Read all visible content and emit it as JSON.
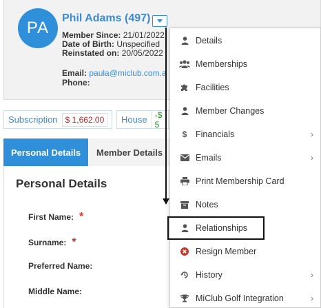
{
  "member": {
    "initials": "PA",
    "name": "Phil Adams (497)",
    "member_since_label": "Member Since:",
    "member_since": "21/01/2022",
    "dob_label": "Date of Birth:",
    "dob": "Unspecified",
    "reinstated_label": "Reinstated on:",
    "reinstated": "20/05/2022",
    "email_label": "Email:",
    "email": "paula@miclub.com.a",
    "phone_label": "Phone:"
  },
  "balances": {
    "subscription_label": "Subscription",
    "subscription_value": "$ 1,662.00",
    "house_label": "House",
    "house_value": "-$ 5"
  },
  "tabs": [
    {
      "label": "Personal Details",
      "active": true
    },
    {
      "label": "Member Details",
      "active": false
    }
  ],
  "section": {
    "title": "Personal Details",
    "fields": [
      {
        "label": "First Name:",
        "required": "*"
      },
      {
        "label": "Surname:",
        "required": "*"
      },
      {
        "label": "Preferred Name:"
      },
      {
        "label": "Middle Name:"
      }
    ]
  },
  "menu": {
    "items": [
      {
        "label": "Details",
        "icon": "user-icon"
      },
      {
        "label": "Memberships",
        "icon": "users-icon"
      },
      {
        "label": "Facilities",
        "icon": "puzzle-icon"
      },
      {
        "label": "Member Changes",
        "icon": "user-icon"
      },
      {
        "label": "Financials",
        "icon": "dollar-icon",
        "submenu": "›"
      },
      {
        "label": "Emails",
        "icon": "envelope-icon",
        "submenu": "›"
      },
      {
        "label": "Print Membership Card",
        "icon": "print-icon"
      },
      {
        "label": "Notes",
        "icon": "archive-icon"
      },
      {
        "label": "Relationships",
        "icon": "user-icon",
        "highlighted": true
      },
      {
        "label": "Resign Member",
        "icon": "times-circle-icon"
      },
      {
        "label": "History",
        "icon": "history-icon",
        "submenu": "›"
      },
      {
        "label": "MiClub Golf Integration",
        "icon": "trophy-icon",
        "submenu": "›"
      }
    ]
  },
  "colors": {
    "accent": "#2f8fd8",
    "link": "#3b8bd4",
    "danger": "#c0392b",
    "negative_value": "#b02a2a",
    "positive_value": "#2e8b2e"
  }
}
